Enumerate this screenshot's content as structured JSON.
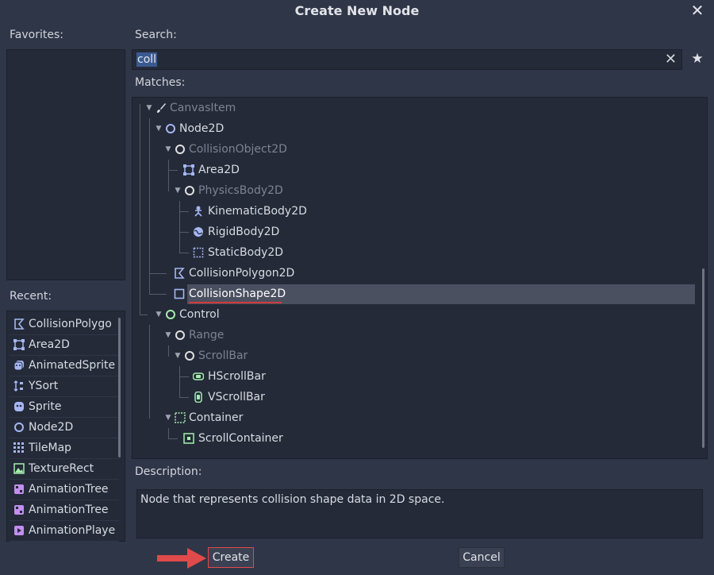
{
  "dialog": {
    "title": "Create New Node",
    "close_icon": "close-icon"
  },
  "favorites": {
    "label": "Favorites:"
  },
  "search": {
    "label": "Search:",
    "value": "coll",
    "clear_icon": "clear-icon",
    "favorite_icon": "star-icon"
  },
  "matches": {
    "label": "Matches:",
    "items": [
      {
        "label": "CanvasItem",
        "dim": true,
        "icon": "brush-icon"
      },
      {
        "label": "Node2D",
        "dim": false,
        "icon": "node2d-circle-icon"
      },
      {
        "label": "CollisionObject2D",
        "dim": true,
        "icon": "circle-icon"
      },
      {
        "label": "Area2D",
        "dim": false,
        "icon": "area2d-icon"
      },
      {
        "label": "PhysicsBody2D",
        "dim": true,
        "icon": "circle-icon"
      },
      {
        "label": "KinematicBody2D",
        "dim": false,
        "icon": "kinematic-icon"
      },
      {
        "label": "RigidBody2D",
        "dim": false,
        "icon": "rigidbody-icon"
      },
      {
        "label": "StaticBody2D",
        "dim": false,
        "icon": "staticbody-icon"
      },
      {
        "label": "CollisionPolygon2D",
        "dim": false,
        "icon": "collision-polygon-icon"
      },
      {
        "label": "CollisionShape2D",
        "dim": false,
        "icon": "collision-shape-icon"
      },
      {
        "label": "Control",
        "dim": false,
        "icon": "control-circle-icon"
      },
      {
        "label": "Range",
        "dim": true,
        "icon": "circle-icon"
      },
      {
        "label": "ScrollBar",
        "dim": true,
        "icon": "circle-icon"
      },
      {
        "label": "HScrollBar",
        "dim": false,
        "icon": "hscrollbar-icon"
      },
      {
        "label": "VScrollBar",
        "dim": false,
        "icon": "vscrollbar-icon"
      },
      {
        "label": "Container",
        "dim": false,
        "icon": "container-icon"
      },
      {
        "label": "ScrollContainer",
        "dim": false,
        "icon": "scroll-container-icon"
      }
    ],
    "selected": "CollisionShape2D"
  },
  "recent": {
    "label": "Recent:",
    "items": [
      {
        "label": "CollisionPolygo",
        "icon": "collision-polygon-icon"
      },
      {
        "label": "Area2D",
        "icon": "area2d-icon"
      },
      {
        "label": "AnimatedSprite",
        "icon": "animated-sprite-icon"
      },
      {
        "label": "YSort",
        "icon": "ysort-icon"
      },
      {
        "label": "Sprite",
        "icon": "sprite-icon"
      },
      {
        "label": "Node2D",
        "icon": "node2d-circle-icon"
      },
      {
        "label": "TileMap",
        "icon": "tilemap-icon"
      },
      {
        "label": "TextureRect",
        "icon": "texture-rect-icon"
      },
      {
        "label": "AnimationTree",
        "icon": "animation-tree-icon"
      },
      {
        "label": "AnimationTree",
        "icon": "animation-tree-icon"
      },
      {
        "label": "AnimationPlaye",
        "icon": "animation-player-icon"
      }
    ]
  },
  "description": {
    "label": "Description:",
    "text": "Node that represents collision shape data in 2D space."
  },
  "buttons": {
    "create": "Create",
    "cancel": "Cancel"
  },
  "colors": {
    "background": "#2f3647",
    "panel": "#242a38",
    "node2d_blue": "#a5b7f3",
    "control_green": "#a5efac",
    "highlight_red": "#e04a4a"
  }
}
